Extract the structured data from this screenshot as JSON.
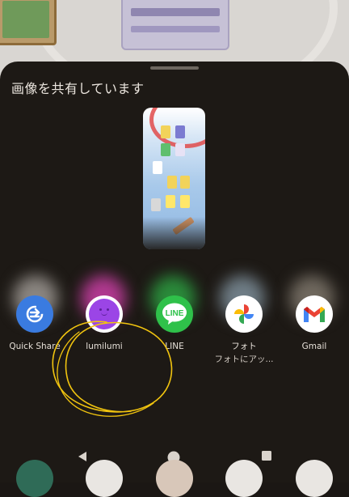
{
  "sheet": {
    "title": "画像を共有しています"
  },
  "apps": [
    {
      "label": "Quick Share",
      "sub": "",
      "icon": "quick-share-icon"
    },
    {
      "label": "lumilumi",
      "sub": "",
      "icon": "lumilumi-icon"
    },
    {
      "label": "LINE",
      "sub": "",
      "icon": "line-icon",
      "icon_text": "LINE"
    },
    {
      "label": "フォト",
      "sub": "フォトにアッ...",
      "icon": "google-photos-icon"
    },
    {
      "label": "Gmail",
      "sub": "",
      "icon": "gmail-icon"
    }
  ],
  "colors": {
    "sheet_bg": "#1d1915",
    "quick_share": "#3a7be0",
    "lumilumi": "#9b45e6",
    "line": "#2fc14a",
    "annotation": "#f1c40f"
  },
  "nav": {
    "back": "back-icon",
    "home": "home-icon",
    "recents": "recents-icon"
  }
}
